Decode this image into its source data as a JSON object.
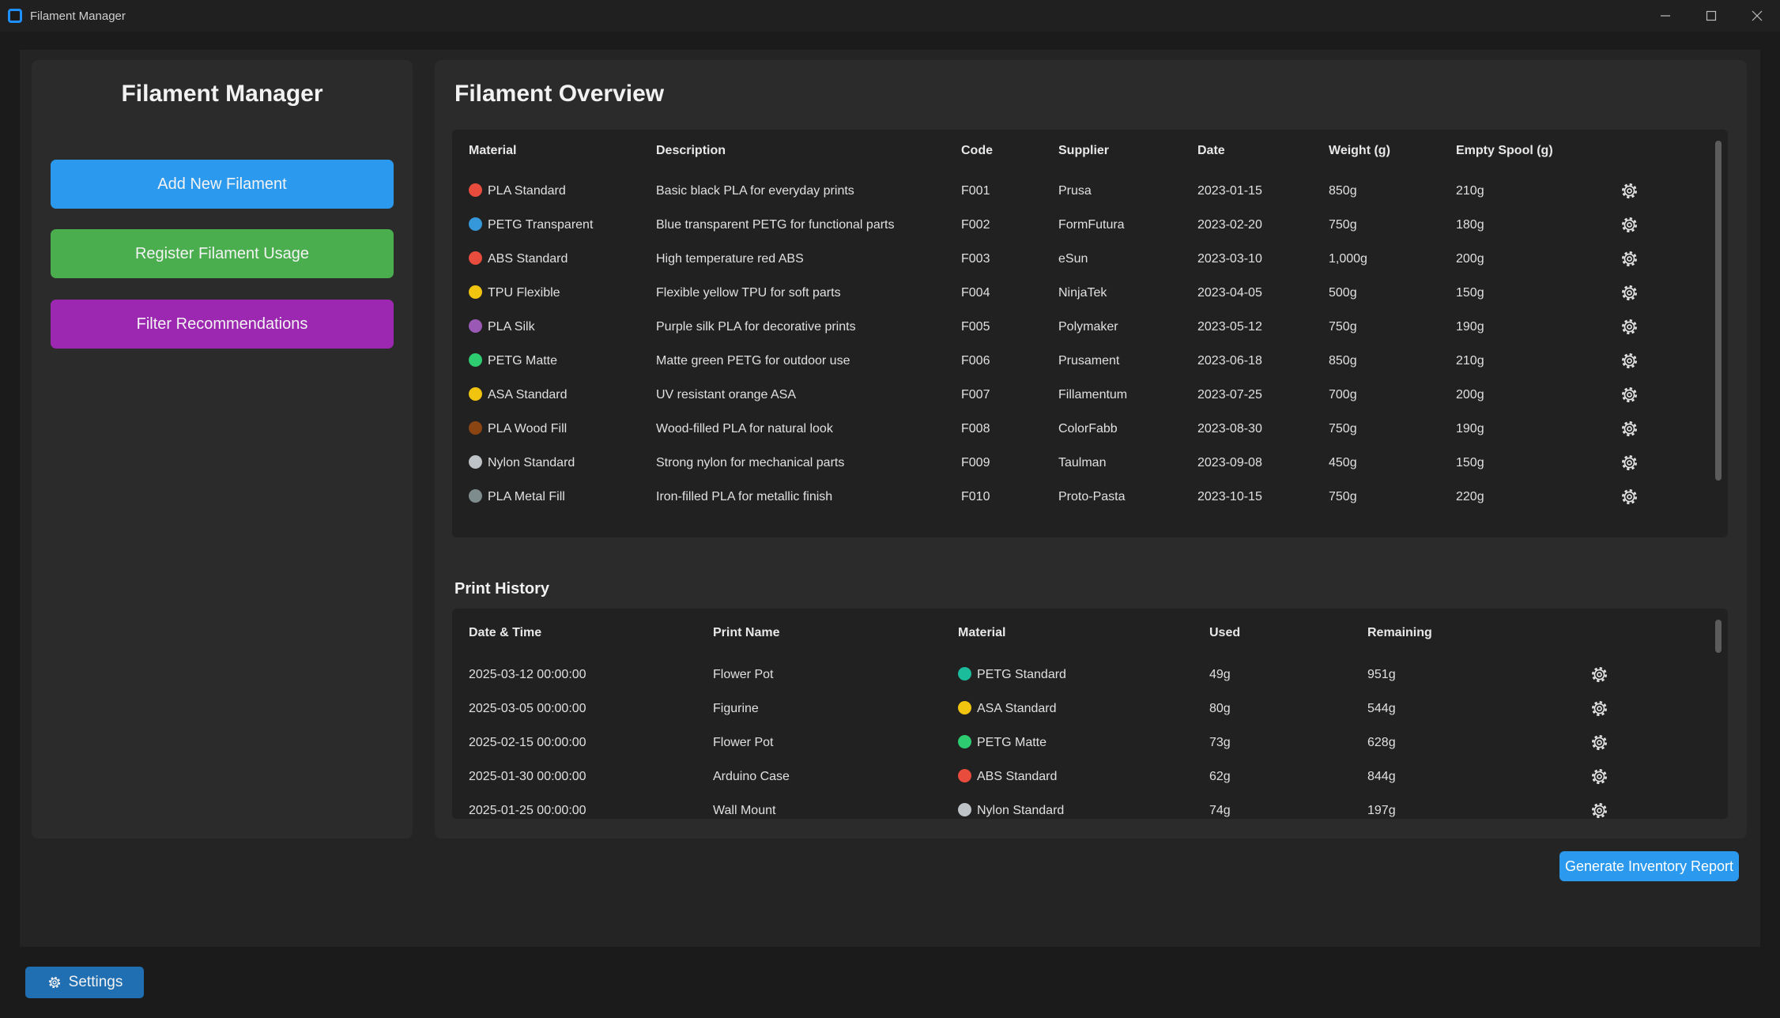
{
  "window": {
    "title": "Filament Manager"
  },
  "sidebar": {
    "title": "Filament Manager",
    "buttons": {
      "add": "Add New Filament",
      "usage": "Register Filament Usage",
      "filter": "Filter Recommendations"
    }
  },
  "overview": {
    "title": "Filament Overview",
    "columns": [
      "Material",
      "Description",
      "Code",
      "Supplier",
      "Date",
      "Weight (g)",
      "Empty Spool (g)"
    ],
    "rows": [
      {
        "material": "PLA Standard",
        "color": "#e74c3c",
        "description": "Basic black PLA for everyday prints",
        "code": "F001",
        "supplier": "Prusa",
        "date": "2023-01-15",
        "weight": "850g",
        "spool": "210g"
      },
      {
        "material": "PETG Transparent",
        "color": "#3498db",
        "description": "Blue transparent PETG for functional parts",
        "code": "F002",
        "supplier": "FormFutura",
        "date": "2023-02-20",
        "weight": "750g",
        "spool": "180g"
      },
      {
        "material": "ABS Standard",
        "color": "#e74c3c",
        "description": "High temperature red ABS",
        "code": "F003",
        "supplier": "eSun",
        "date": "2023-03-10",
        "weight": "1,000g",
        "spool": "200g"
      },
      {
        "material": "TPU Flexible",
        "color": "#f1c40f",
        "description": "Flexible yellow TPU for soft parts",
        "code": "F004",
        "supplier": "NinjaTek",
        "date": "2023-04-05",
        "weight": "500g",
        "spool": "150g"
      },
      {
        "material": "PLA Silk",
        "color": "#9b59b6",
        "description": "Purple silk PLA for decorative prints",
        "code": "F005",
        "supplier": "Polymaker",
        "date": "2023-05-12",
        "weight": "750g",
        "spool": "190g"
      },
      {
        "material": "PETG Matte",
        "color": "#2ecc71",
        "description": "Matte green PETG for outdoor use",
        "code": "F006",
        "supplier": "Prusament",
        "date": "2023-06-18",
        "weight": "850g",
        "spool": "210g"
      },
      {
        "material": "ASA Standard",
        "color": "#f1c40f",
        "description": "UV resistant orange ASA",
        "code": "F007",
        "supplier": "Fillamentum",
        "date": "2023-07-25",
        "weight": "700g",
        "spool": "200g"
      },
      {
        "material": "PLA Wood Fill",
        "color": "#8b4513",
        "description": "Wood-filled PLA for natural look",
        "code": "F008",
        "supplier": "ColorFabb",
        "date": "2023-08-30",
        "weight": "750g",
        "spool": "190g"
      },
      {
        "material": "Nylon Standard",
        "color": "#bdc3c7",
        "description": "Strong nylon for mechanical parts",
        "code": "F009",
        "supplier": "Taulman",
        "date": "2023-09-08",
        "weight": "450g",
        "spool": "150g"
      },
      {
        "material": "PLA Metal Fill",
        "color": "#7f8c8d",
        "description": "Iron-filled PLA for metallic finish",
        "code": "F010",
        "supplier": "Proto-Pasta",
        "date": "2023-10-15",
        "weight": "750g",
        "spool": "220g"
      }
    ]
  },
  "history": {
    "title": "Print History",
    "columns": [
      "Date & Time",
      "Print Name",
      "Material",
      "Used",
      "Remaining"
    ],
    "rows": [
      {
        "datetime": "2025-03-12 00:00:00",
        "name": "Flower Pot",
        "material": "PETG Standard",
        "color": "#1abc9c",
        "used": "49g",
        "remaining": "951g"
      },
      {
        "datetime": "2025-03-05 00:00:00",
        "name": "Figurine",
        "material": "ASA Standard",
        "color": "#f1c40f",
        "used": "80g",
        "remaining": "544g"
      },
      {
        "datetime": "2025-02-15 00:00:00",
        "name": "Flower Pot",
        "material": "PETG Matte",
        "color": "#2ecc71",
        "used": "73g",
        "remaining": "628g"
      },
      {
        "datetime": "2025-01-30 00:00:00",
        "name": "Arduino Case",
        "material": "ABS Standard",
        "color": "#e74c3c",
        "used": "62g",
        "remaining": "844g"
      },
      {
        "datetime": "2025-01-25 00:00:00",
        "name": "Wall Mount",
        "material": "Nylon Standard",
        "color": "#bdc3c7",
        "used": "74g",
        "remaining": "197g"
      }
    ]
  },
  "actions": {
    "report": "Generate Inventory Report",
    "settings": "Settings"
  }
}
